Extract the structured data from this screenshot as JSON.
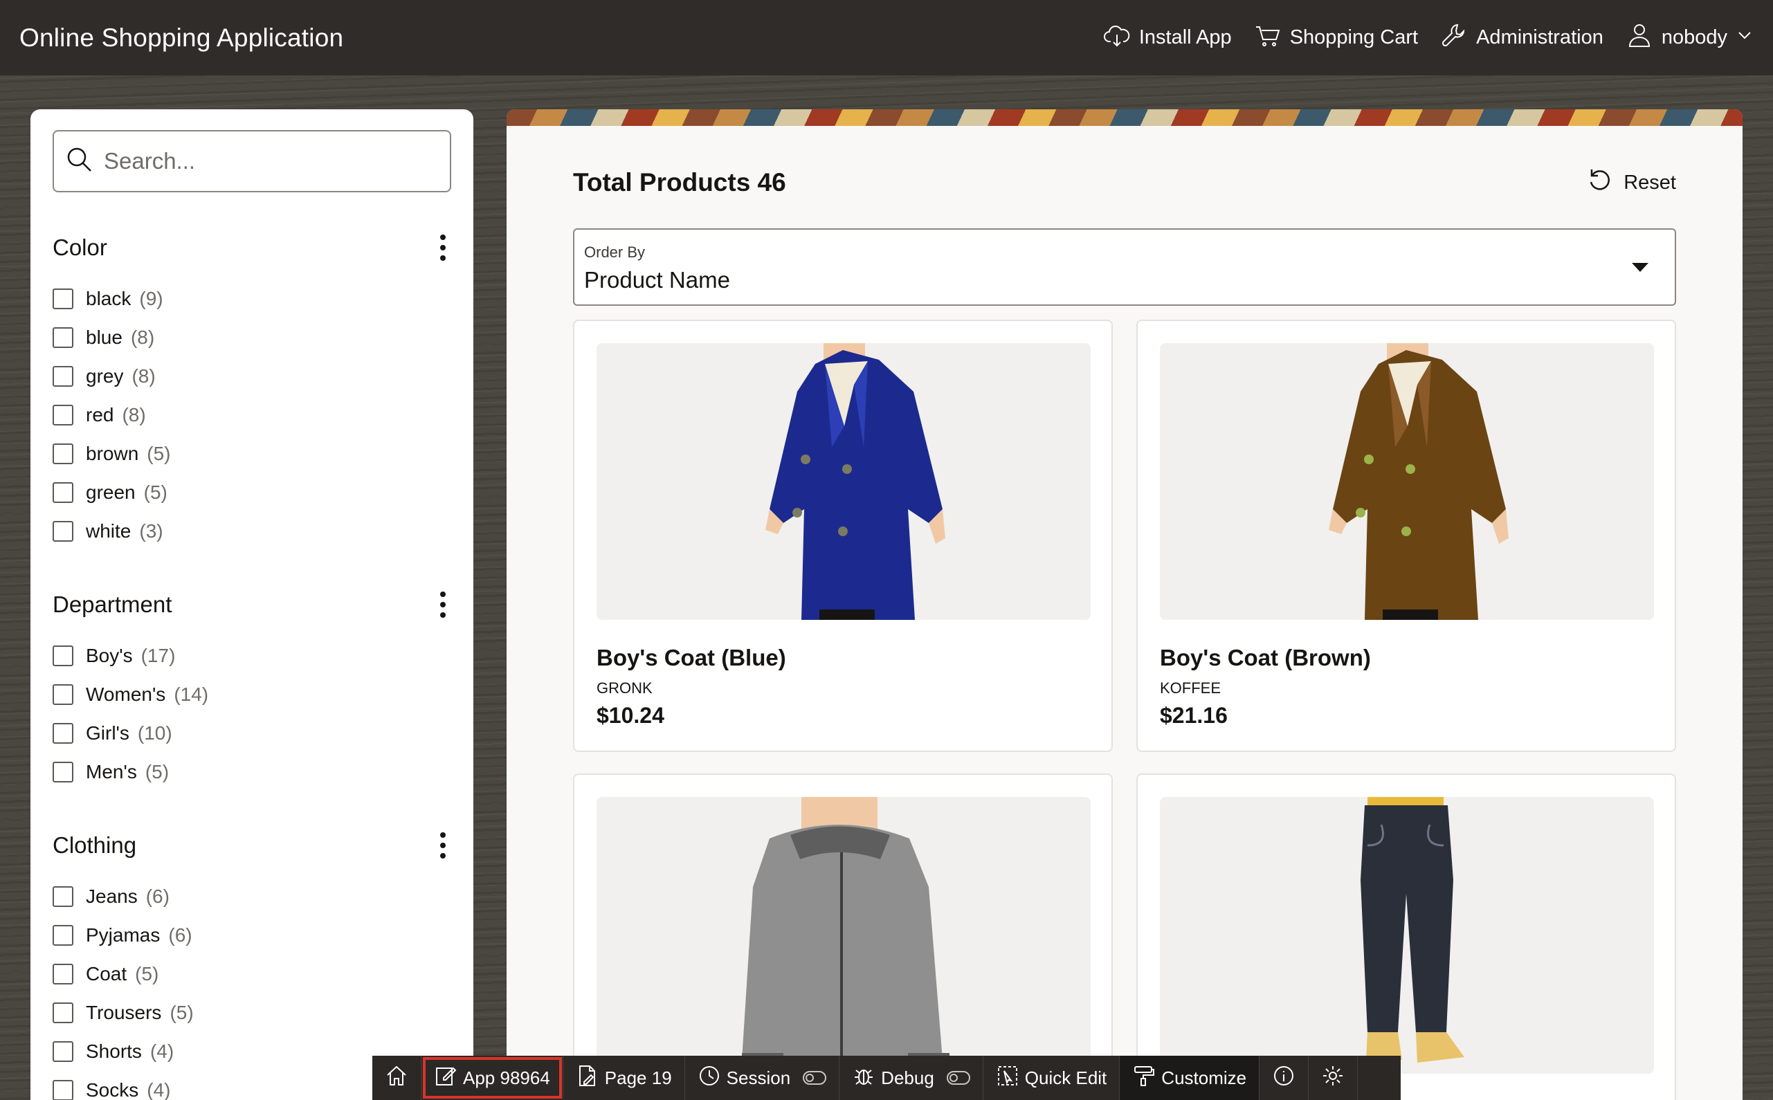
{
  "header": {
    "title": "Online Shopping Application",
    "install_label": "Install App",
    "cart_label": "Shopping Cart",
    "admin_label": "Administration",
    "user_label": "nobody"
  },
  "search": {
    "placeholder": "Search..."
  },
  "facets": {
    "color": {
      "title": "Color",
      "options": [
        {
          "label": "black",
          "count": "(9)"
        },
        {
          "label": "blue",
          "count": "(8)"
        },
        {
          "label": "grey",
          "count": "(8)"
        },
        {
          "label": "red",
          "count": "(8)"
        },
        {
          "label": "brown",
          "count": "(5)"
        },
        {
          "label": "green",
          "count": "(5)"
        },
        {
          "label": "white",
          "count": "(3)"
        }
      ]
    },
    "department": {
      "title": "Department",
      "options": [
        {
          "label": "Boy's",
          "count": "(17)"
        },
        {
          "label": "Women's",
          "count": "(14)"
        },
        {
          "label": "Girl's",
          "count": "(10)"
        },
        {
          "label": "Men's",
          "count": "(5)"
        }
      ]
    },
    "clothing": {
      "title": "Clothing",
      "options": [
        {
          "label": "Jeans",
          "count": "(6)"
        },
        {
          "label": "Pyjamas",
          "count": "(6)"
        },
        {
          "label": "Coat",
          "count": "(5)"
        },
        {
          "label": "Trousers",
          "count": "(5)"
        },
        {
          "label": "Shorts",
          "count": "(4)"
        },
        {
          "label": "Socks",
          "count": "(4)"
        }
      ]
    }
  },
  "main": {
    "total_label": "Total Products 46",
    "reset_label": "Reset",
    "order_by_label": "Order By",
    "order_by_value": "Product Name"
  },
  "products": [
    {
      "name": "Boy's Coat (Blue)",
      "brand": "GRONK",
      "price": "$10.24",
      "image": "blue-coat",
      "color": "#1c2a8f"
    },
    {
      "name": "Boy's Coat (Brown)",
      "brand": "KOFFEE",
      "price": "$21.16",
      "image": "brown-coat",
      "color": "#6b4414"
    },
    {
      "name": "",
      "brand": "",
      "price": "",
      "image": "grey-hoodie",
      "color": "#8f8f8f"
    },
    {
      "name": "",
      "brand": "",
      "price": "",
      "image": "dark-jeans",
      "color": "#2a2f3a"
    }
  ],
  "devbar": {
    "app_label": "App 98964",
    "page_label": "Page 19",
    "session_label": "Session",
    "debug_label": "Debug",
    "quick_edit_label": "Quick Edit",
    "customize_label": "Customize"
  },
  "colors": {
    "header_bg": "#2f2c29",
    "devbar_bg": "#2b2825",
    "highlight": "#d9342b"
  }
}
